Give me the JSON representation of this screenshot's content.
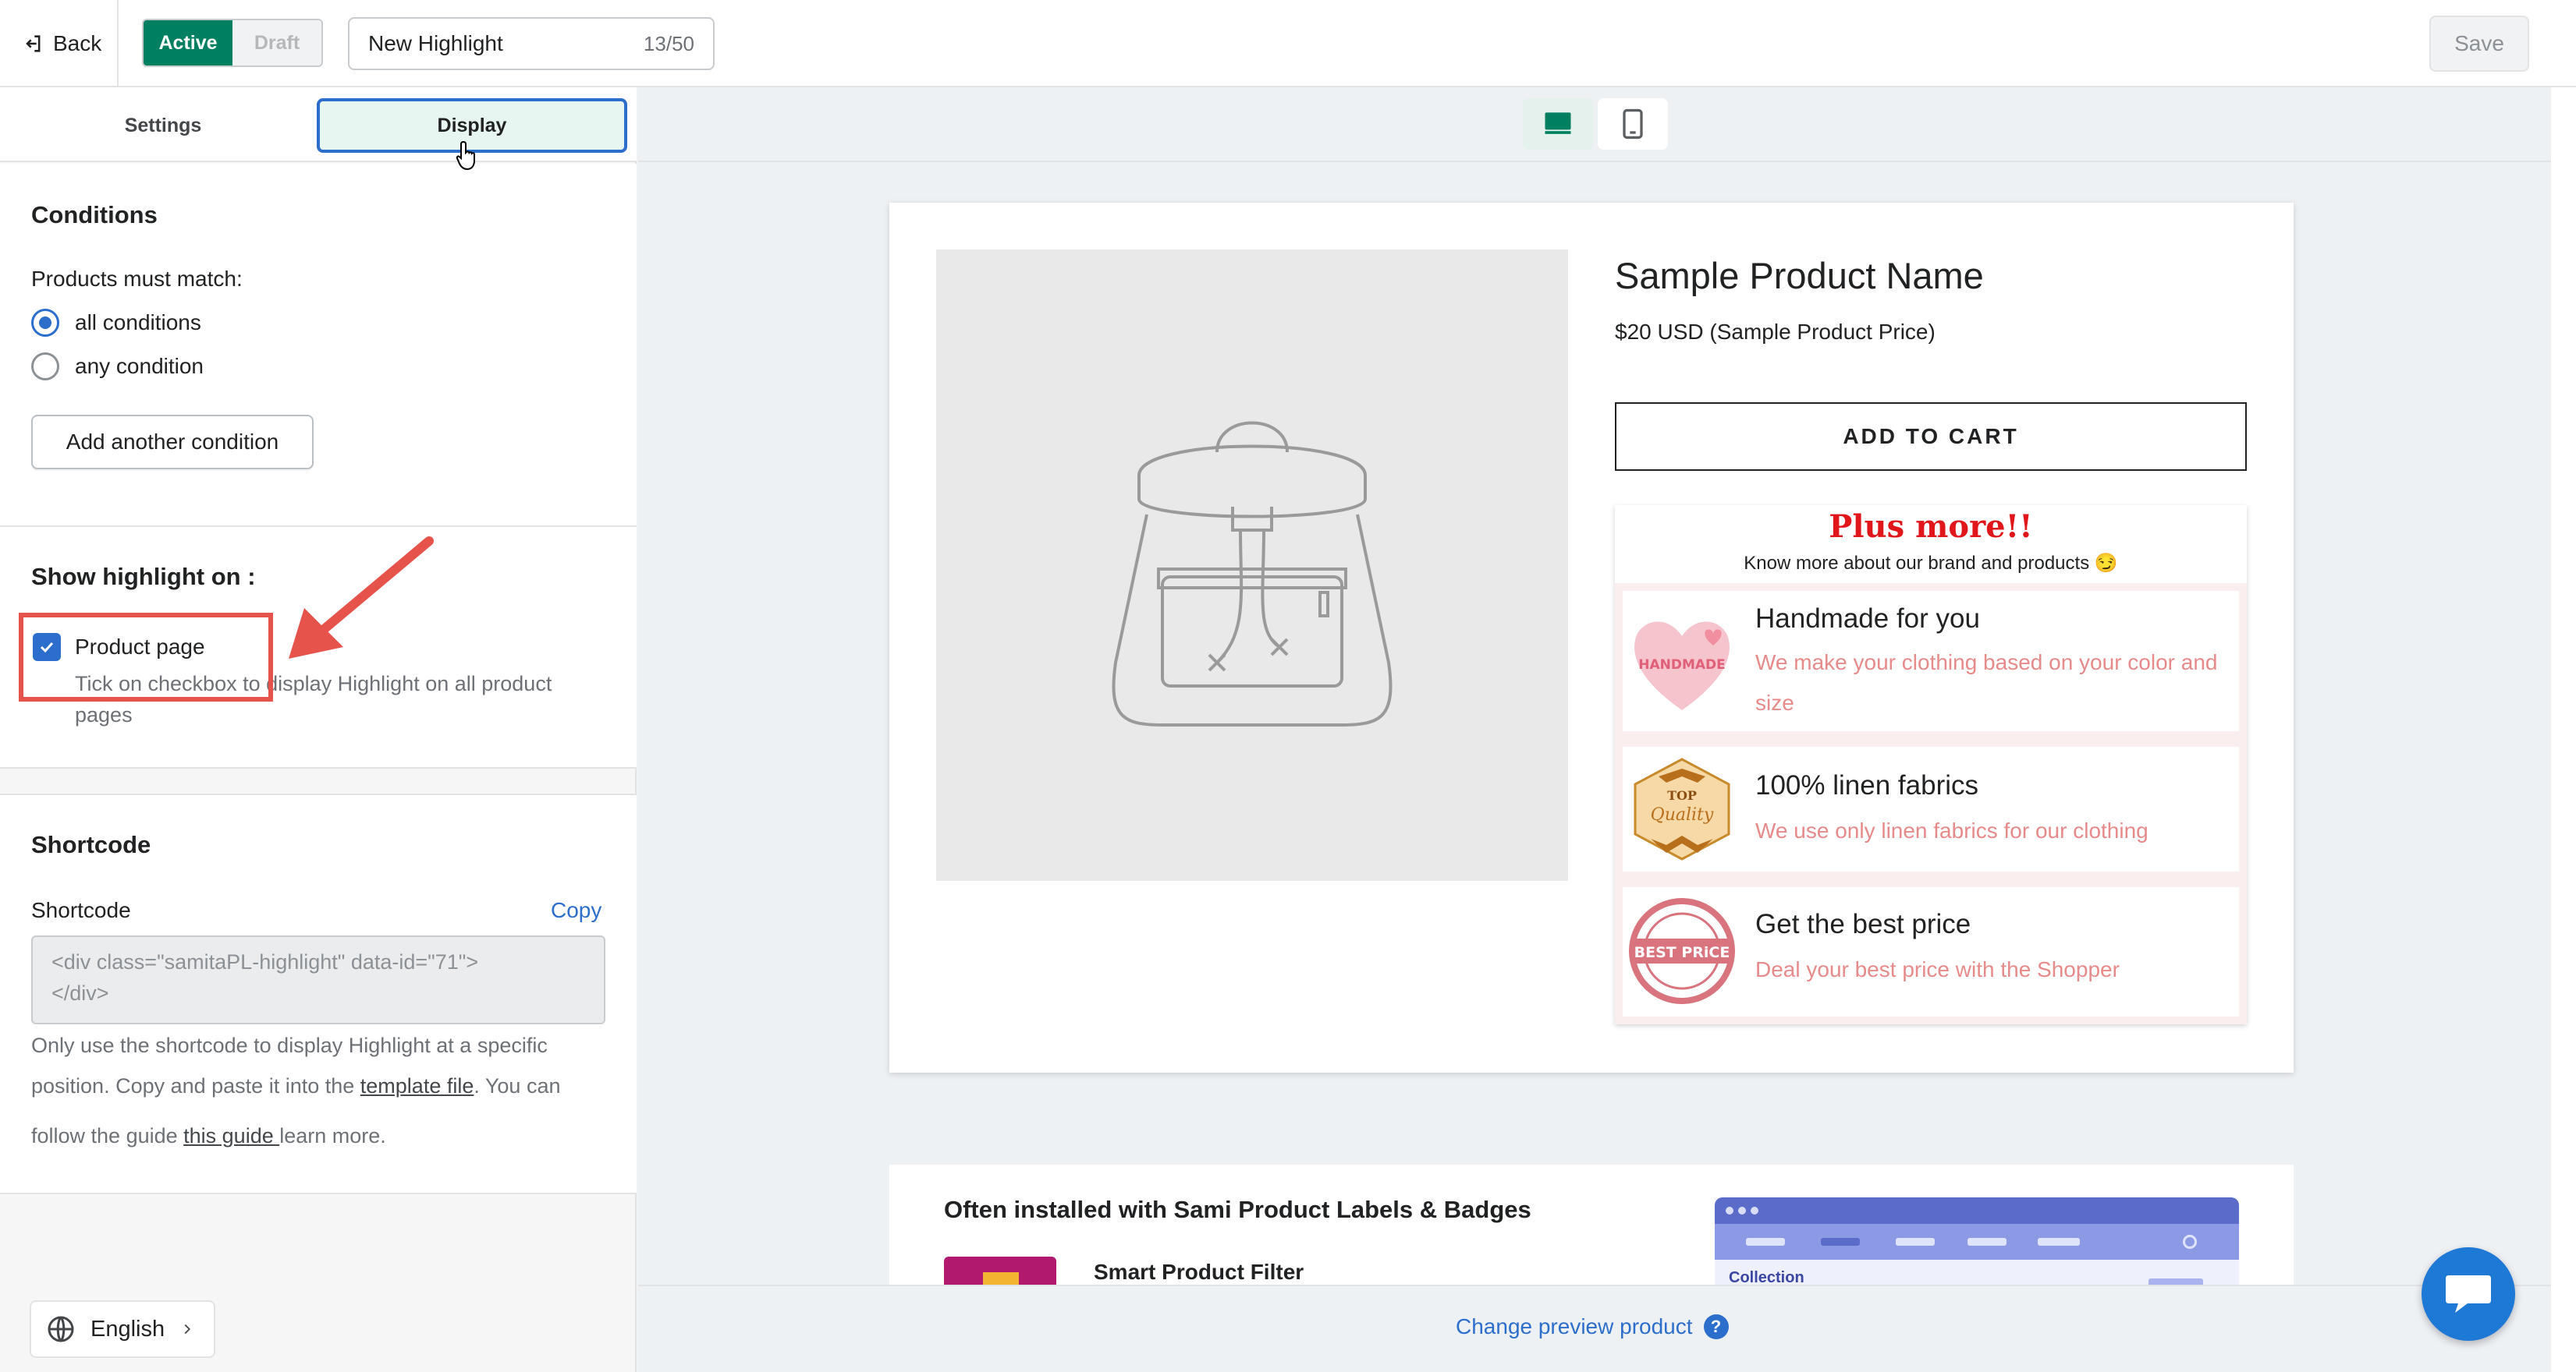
{
  "topbar": {
    "back_label": "Back",
    "status_active": "Active",
    "status_draft": "Draft",
    "title_value": "New Highlight",
    "title_count": "13/50",
    "save_label": "Save"
  },
  "tabs": {
    "settings": "Settings",
    "display": "Display",
    "selected": "Display"
  },
  "conditions": {
    "heading": "Conditions",
    "match_label": "Products must match:",
    "option_all": "all conditions",
    "option_any": "any condition",
    "selected": "all conditions",
    "add_button": "Add another condition"
  },
  "show_on": {
    "heading": "Show highlight on :",
    "product_page_label": "Product page",
    "product_page_checked": true,
    "help_text_1": "Tick on checkbox to display Highlight on all product",
    "help_text_2": "pages"
  },
  "shortcode": {
    "heading": "Shortcode",
    "field_label": "Shortcode",
    "copy_label": "Copy",
    "code_line_1": "<div class=\"samitaPL-highlight\" data-id=\"71\">",
    "code_line_2": "</div>",
    "help_1": "Only use the shortcode to display Highlight at a specific",
    "help_2a": "position. Copy and paste it into the ",
    "help_2_link": "template file",
    "help_2b": ". You can",
    "help_3a": "follow the guide ",
    "help_3_link": "this guide ",
    "help_3b": "learn more."
  },
  "language": {
    "label": "English"
  },
  "preview": {
    "device_selected": "desktop",
    "product_name": "Sample Product Name",
    "product_price": "$20 USD (Sample Product Price)",
    "add_to_cart": "ADD TO CART",
    "highlight_title": "Plus more!!",
    "highlight_subtitle": "Know more about our brand and products 😏",
    "items": [
      {
        "title": "Handmade for you",
        "desc": "We make your clothing based on your color and size",
        "icon_text": "HANDMADE"
      },
      {
        "title": "100% linen fabrics",
        "desc": "We use only linen fabrics for our clothing",
        "icon_text_1": "TOP",
        "icon_text_2": "Quality"
      },
      {
        "title": "Get the best price",
        "desc": "Deal your best price with the Shopper",
        "icon_text": "BEST PRiCE"
      }
    ],
    "often_title": "Often installed with Sami Product Labels & Badges",
    "app_name": "Smart Product Filter",
    "mock_collection": "Collection",
    "change_product": "Change preview product",
    "help_glyph": "?"
  },
  "colors": {
    "primary_green": "#008060",
    "accent_blue": "#2c6ecb",
    "highlight_red": "#e0161b",
    "highlight_desc": "#e78a8a",
    "annotation_red": "#e5534b"
  }
}
